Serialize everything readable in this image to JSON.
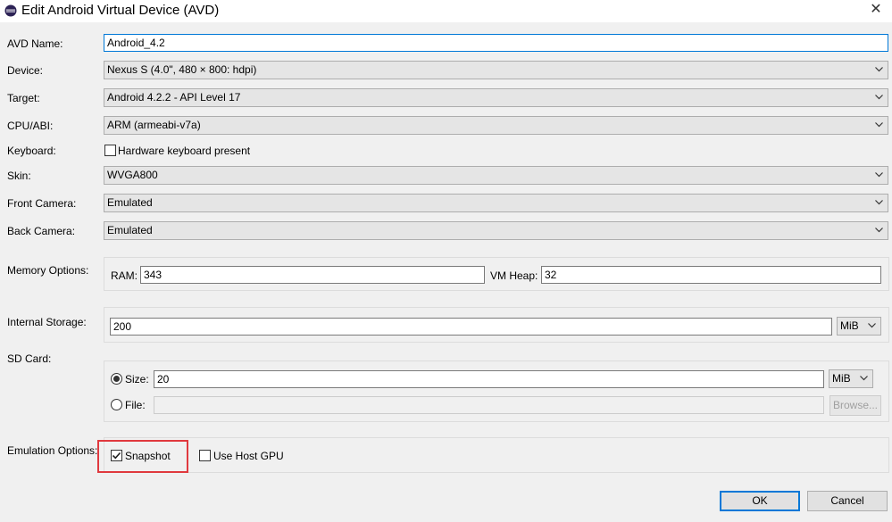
{
  "window": {
    "title": "Edit Android Virtual Device (AVD)",
    "app_icon": "eclipse-icon",
    "close_glyph": "✕"
  },
  "form": {
    "avd_name": {
      "label": "AVD Name:",
      "value": "Android_4.2"
    },
    "device": {
      "label": "Device:",
      "value": "Nexus S (4.0\", 480 × 800: hdpi)"
    },
    "target": {
      "label": "Target:",
      "value": "Android 4.2.2 - API Level 17"
    },
    "cpu_abi": {
      "label": "CPU/ABI:",
      "value": "ARM (armeabi-v7a)"
    },
    "keyboard": {
      "label": "Keyboard:",
      "checkbox_label": "Hardware keyboard present",
      "checked": false
    },
    "skin": {
      "label": "Skin:",
      "value": "WVGA800"
    },
    "front_camera": {
      "label": "Front Camera:",
      "value": "Emulated"
    },
    "back_camera": {
      "label": "Back Camera:",
      "value": "Emulated"
    },
    "memory": {
      "label": "Memory Options:",
      "ram_label": "RAM:",
      "ram_value": "343",
      "vm_heap_label": "VM Heap:",
      "vm_heap_value": "32"
    },
    "internal_storage": {
      "label": "Internal Storage:",
      "value": "200",
      "unit": "MiB"
    },
    "sd_card": {
      "label": "SD Card:",
      "size_label": "Size:",
      "size_value": "20",
      "size_unit": "MiB",
      "size_selected": true,
      "file_label": "File:",
      "file_value": "",
      "browse_label": "Browse..."
    },
    "emulation": {
      "label": "Emulation Options:",
      "snapshot_label": "Snapshot",
      "snapshot_checked": true,
      "host_gpu_label": "Use Host GPU",
      "host_gpu_checked": false
    }
  },
  "buttons": {
    "ok": "OK",
    "cancel": "Cancel"
  },
  "colors": {
    "highlight": "#e0393e",
    "focus_border": "#0078d7"
  }
}
